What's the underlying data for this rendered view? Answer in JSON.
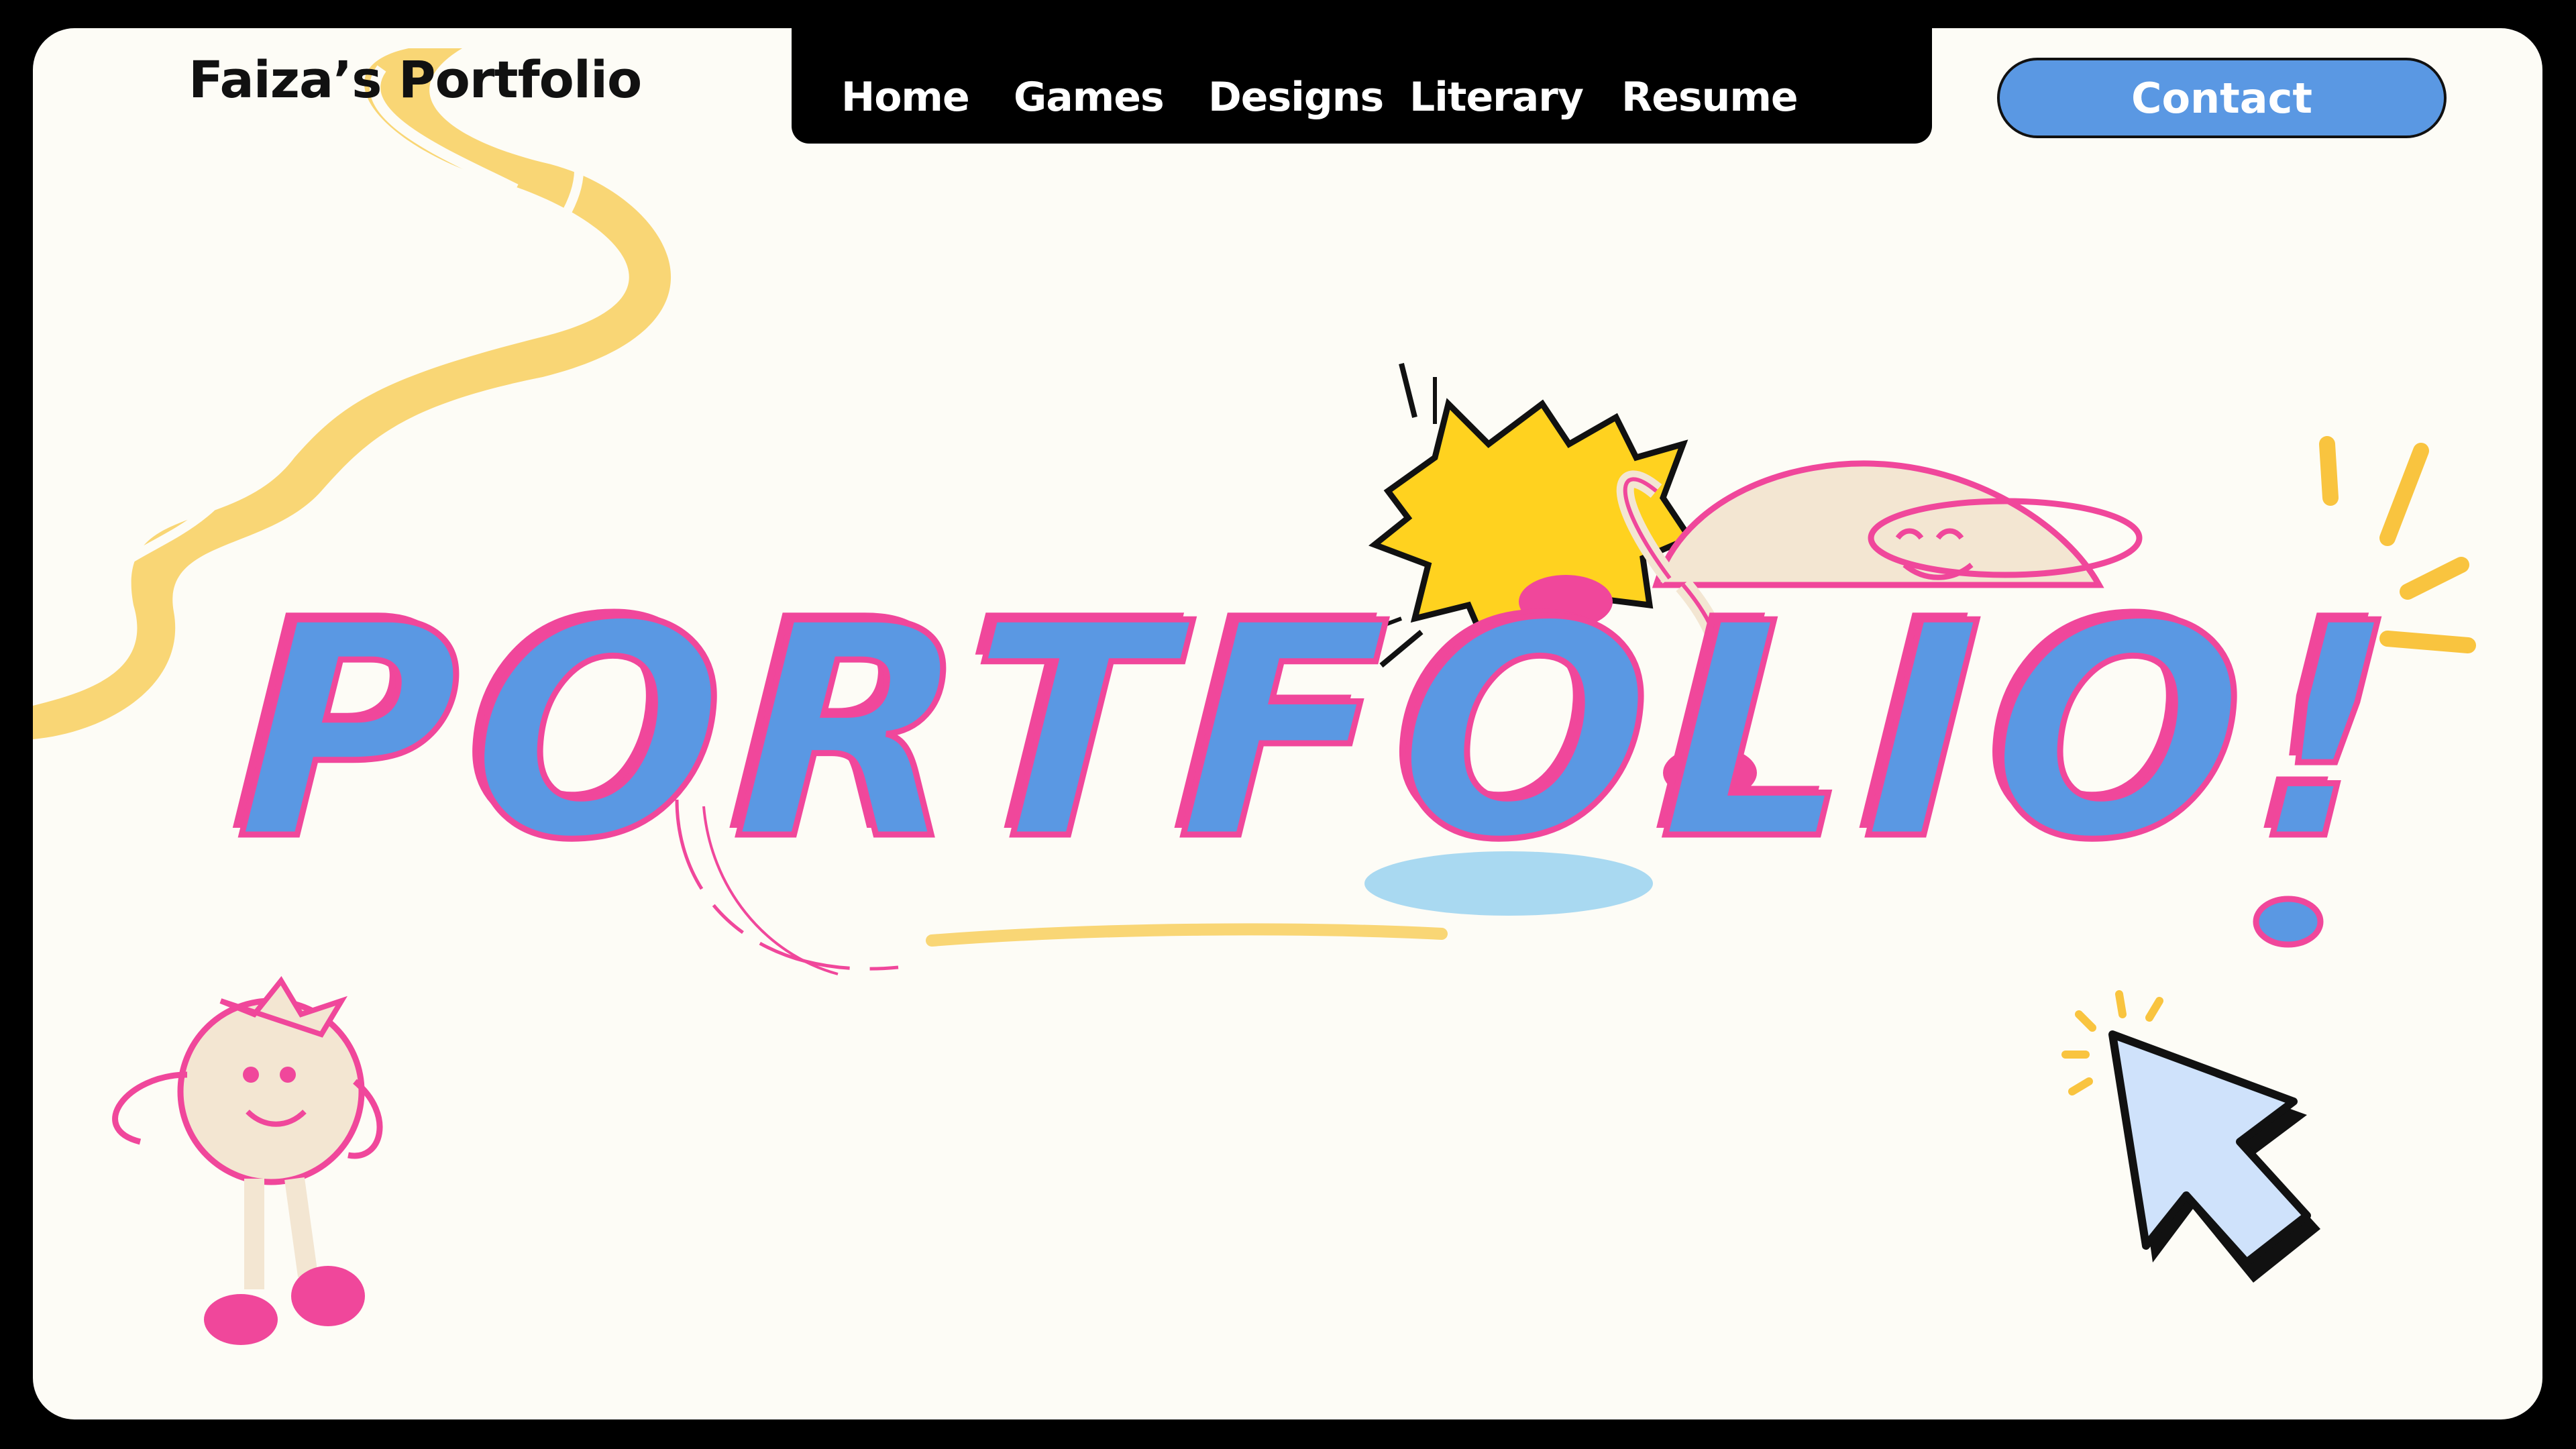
{
  "header": {
    "brand": "Faiza’s Portfolio",
    "nav": [
      "Home",
      "Games",
      "Designs",
      "Literary",
      "Resume"
    ],
    "contact_label": "Contact"
  },
  "hero": {
    "title": "PORTFOLIO!"
  },
  "colors": {
    "background": "#000000",
    "card": "#FDFCF6",
    "blue": "#5A98E3",
    "pink": "#F0479B",
    "yellow": "#F9D675",
    "burst": "#FFD21F",
    "cursor_fill": "#CFE2FB"
  },
  "icons": [
    "squiggle-decoration",
    "comic-burst-icon",
    "lounging-bun-character",
    "tomato-character",
    "mouse-cursor-icon",
    "sparkle-lines-icon"
  ]
}
